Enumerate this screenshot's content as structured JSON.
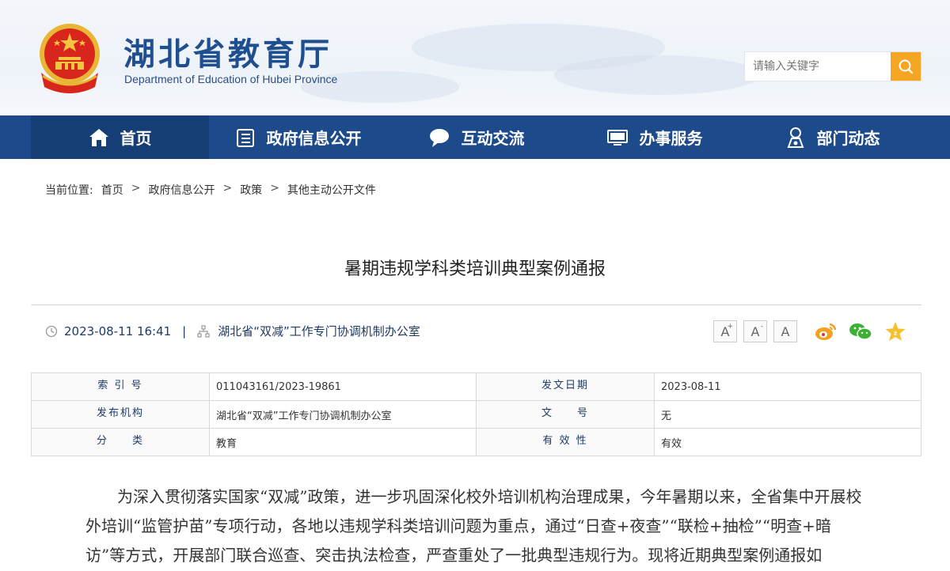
{
  "header": {
    "title": "湖北省教育厅",
    "subtitle": "Department of Education of Hubei Province",
    "search_placeholder": "请输入关键字"
  },
  "nav": {
    "items": [
      {
        "label": "首页",
        "icon": "home-icon"
      },
      {
        "label": "政府信息公开",
        "icon": "document-icon"
      },
      {
        "label": "互动交流",
        "icon": "chat-bubble-icon"
      },
      {
        "label": "办事服务",
        "icon": "monitor-icon"
      },
      {
        "label": "部门动态",
        "icon": "person-badge-icon"
      }
    ]
  },
  "breadcrumb": {
    "prefix": "当前位置:",
    "items": [
      "首页",
      "政府信息公开",
      "政策",
      "其他主动公开文件"
    ],
    "separator": ">"
  },
  "article": {
    "title": "暑期违规学科类培训典型案例通报",
    "datetime": "2023-08-11 16:41",
    "pipe": "|",
    "publisher": "湖北省“双减”工作专门协调机制办公室",
    "font_buttons": [
      "A",
      "A",
      "A"
    ],
    "info": {
      "index_label": "索 引 号",
      "index_value": "011043161/2023-19861",
      "date_label": "发文日期",
      "date_value": "2023-08-11",
      "org_label": "发布机构",
      "org_value": "湖北省“双减”工作专门协调机制办公室",
      "docno_label": "文　　号",
      "docno_value": "无",
      "category_label": "分　　类",
      "category_value": "教育",
      "validity_label": "有 效 性",
      "validity_value": "有效"
    },
    "body": "为深入贯彻落实国家“双减”政策，进一步巩固深化校外培训机构治理成果，今年暑期以来，全省集中开展校外培训“监管护苗”专项行动，各地以违规学科类培训问题为重点，通过“日查+夜查”“联检+抽检”“明查+暗访”等方式，开展部门联合巡查、突击执法检查，严查重处了一批典型违规行为。现将近期典型案例通报如"
  },
  "colors": {
    "nav_bg": "#1c4a8a",
    "nav_active": "#153d76",
    "title_blue": "#1f4f8f",
    "search_btn": "#f5a623"
  }
}
